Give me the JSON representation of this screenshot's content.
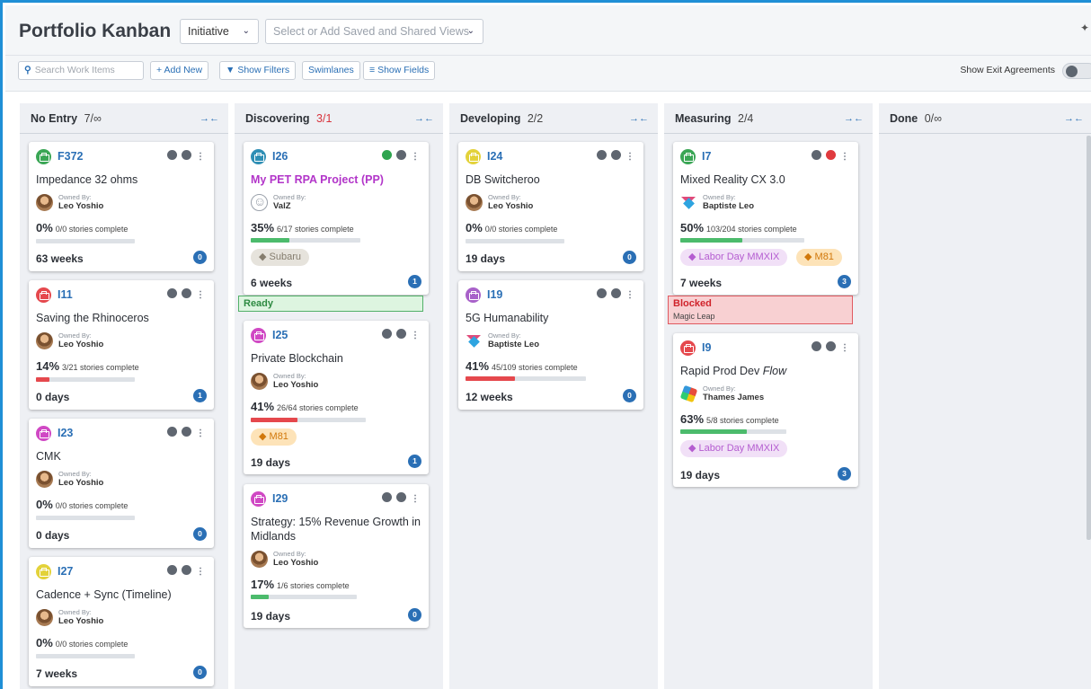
{
  "header": {
    "title": "Portfolio Kanban",
    "level_select": "Initiative",
    "views_placeholder": "Select or Add Saved and Shared Views"
  },
  "toolbar": {
    "search_placeholder": "Search Work Items",
    "add_new": "+ Add New",
    "show_filters": "Show Filters",
    "swimlanes": "Swimlanes",
    "show_fields": "Show Fields",
    "exit_agreements_label": "Show Exit Agreements"
  },
  "owned_by_label": "Owned By:",
  "columns": [
    {
      "name": "No Entry",
      "count": "7/∞"
    },
    {
      "name": "Discovering",
      "count": "3/1"
    },
    {
      "name": "Developing",
      "count": "2/2"
    },
    {
      "name": "Measuring",
      "count": "2/4"
    },
    {
      "name": "Done",
      "count": "0/∞"
    }
  ],
  "cards": {
    "F372": {
      "id": "F372",
      "title": "Impedance 32 ohms",
      "owner": "Leo Yoshio",
      "pct": "0%",
      "stories": "0/0 stories complete",
      "progress": 0,
      "duration": "63 weeks",
      "discussions": "0",
      "icon_color": "#3aa655"
    },
    "I11": {
      "id": "I11",
      "title": "Saving the Rhinoceros",
      "owner": "Leo Yoshio",
      "pct": "14%",
      "stories": "3/21 stories complete",
      "progress": 14,
      "duration": "0 days",
      "discussions": "1",
      "icon_color": "#e5484d"
    },
    "I23": {
      "id": "I23",
      "title": "CMK",
      "owner": "Leo Yoshio",
      "pct": "0%",
      "stories": "0/0 stories complete",
      "progress": 0,
      "duration": "0 days",
      "discussions": "0",
      "icon_color": "#d048c4"
    },
    "I27": {
      "id": "I27",
      "title": "Cadence + Sync (Timeline)",
      "owner": "Leo Yoshio",
      "pct": "0%",
      "stories": "0/0 stories complete",
      "progress": 0,
      "duration": "7 weeks",
      "discussions": "0",
      "icon_color": "#e3d23a"
    },
    "I26": {
      "id": "I26",
      "title": "My PET RPA Project (PP)",
      "owner": "ValZ",
      "pct": "35%",
      "stories": "6/17 stories complete",
      "progress": 35,
      "tag": "Subaru",
      "duration": "6 weeks",
      "discussions": "1",
      "status": "Ready",
      "icon_color": "#2f8fb5"
    },
    "I25": {
      "id": "I25",
      "title": "Private Blockchain",
      "owner": "Leo Yoshio",
      "pct": "41%",
      "stories": "26/64 stories complete",
      "progress": 41,
      "tag": "M81",
      "duration": "19 days",
      "discussions": "1",
      "icon_color": "#d048c4"
    },
    "I29": {
      "id": "I29",
      "title": "Strategy: 15% Revenue Growth in Midlands",
      "owner": "Leo Yoshio",
      "pct": "17%",
      "stories": "1/6 stories complete",
      "progress": 17,
      "duration": "19 days",
      "discussions": "0",
      "icon_color": "#d048c4"
    },
    "I24": {
      "id": "I24",
      "title": "DB Switcheroo",
      "owner": "Leo Yoshio",
      "pct": "0%",
      "stories": "0/0 stories complete",
      "progress": 0,
      "duration": "19 days",
      "discussions": "0",
      "icon_color": "#e3d23a"
    },
    "I19": {
      "id": "I19",
      "title": "5G Humanability",
      "owner": "Baptiste Leo",
      "pct": "41%",
      "stories": "45/109 stories complete",
      "progress": 41,
      "duration": "12 weeks",
      "discussions": "0",
      "icon_color": "#a861c9"
    },
    "I7": {
      "id": "I7",
      "title": "Mixed Reality CX 3.0",
      "owner": "Baptiste Leo",
      "pct": "50%",
      "stories": "103/204 stories complete",
      "progress": 50,
      "tag1": "Labor Day MMXIX",
      "tag2": "M81",
      "duration": "7 weeks",
      "discussions": "3",
      "status": "Blocked",
      "status_detail": "Magic Leap",
      "icon_color": "#3aa655"
    },
    "I9": {
      "id": "I9",
      "title": "Rapid Prod Dev",
      "title_italic": "Flow",
      "owner": "Thames James",
      "pct": "63%",
      "stories": "5/8 stories complete",
      "progress": 63,
      "tag": "Labor Day MMXIX",
      "duration": "19 days",
      "discussions": "3",
      "icon_color": "#e5484d"
    }
  },
  "colors": {
    "accent": "#2a6fb5",
    "progress_red": "#e5484d",
    "progress_green": "#4cbb6c",
    "over_limit": "#d8333c"
  }
}
